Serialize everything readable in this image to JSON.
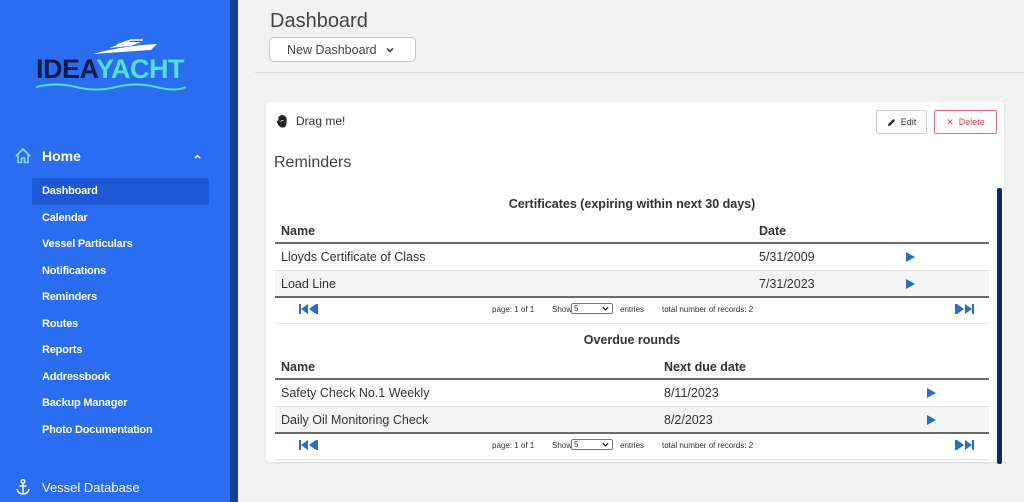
{
  "sidebar": {
    "logo": {
      "part1": "IDEA",
      "part2": "YACHT"
    },
    "home_label": "Home",
    "items": [
      {
        "label": "Dashboard",
        "active": true
      },
      {
        "label": "Calendar"
      },
      {
        "label": "Vessel Particulars"
      },
      {
        "label": "Notifications"
      },
      {
        "label": "Reminders"
      },
      {
        "label": "Routes"
      },
      {
        "label": "Reports"
      },
      {
        "label": "Addressbook"
      },
      {
        "label": "Backup Manager"
      },
      {
        "label": "Photo Documentation"
      }
    ],
    "vessel_database_label": "Vessel Database"
  },
  "header": {
    "title": "Dashboard",
    "dashboard_select": "New Dashboard"
  },
  "widget": {
    "drag_label": "Drag me!",
    "edit_label": "Edit",
    "delete_label": "Delete",
    "title": "Reminders",
    "certificates": {
      "title": "Certificates (expiring within next 30 days)",
      "columns": [
        "Name",
        "Date"
      ],
      "rows": [
        {
          "name": "Lloyds Certificate of Class",
          "date": "5/31/2009"
        },
        {
          "name": "Load Line",
          "date": "7/31/2023"
        }
      ],
      "pager": {
        "page": "page: 1 of 1",
        "show": "Show",
        "entries_value": "5",
        "entries": "entries",
        "total": "total number of records: 2"
      }
    },
    "overdue": {
      "title": "Overdue rounds",
      "columns": [
        "Name",
        "Next due date"
      ],
      "rows": [
        {
          "name": "Safety Check No.1 Weekly",
          "date": "8/11/2023"
        },
        {
          "name": "Daily Oil Monitoring Check",
          "date": "8/2/2023"
        }
      ],
      "pager": {
        "page": "page: 1 of 1",
        "show": "Show",
        "entries_value": "5",
        "entries": "entries",
        "total": "total number of records: 2"
      }
    }
  },
  "colors": {
    "sidebar": "#2a6df0",
    "sidebar_active": "#1e58d4",
    "accent_teal": "#4fe0d8",
    "play_blue": "#2b6cc4",
    "delete_red": "#e0475c"
  }
}
